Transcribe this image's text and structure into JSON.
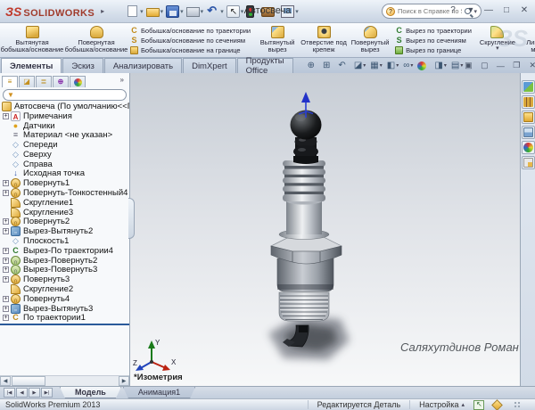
{
  "title_bar": {
    "logo_mark": "ЗS",
    "logo_text": "SOLIDWORKS",
    "document_title": "Автосвеча",
    "search_placeholder": "Поиск в Справке по SolidWorks",
    "menu_icons": [
      {
        "name": "new-document-icon",
        "icon": "new-document",
        "dd": true
      },
      {
        "name": "open-icon",
        "icon": "open",
        "dd": true
      },
      {
        "name": "save-icon",
        "icon": "save",
        "dd": true
      },
      {
        "name": "print-icon",
        "icon": "print",
        "dd": true
      },
      {
        "name": "undo-icon",
        "icon": "undo",
        "dd": true
      },
      {
        "name": "select-icon",
        "icon": "select",
        "dd": true
      },
      {
        "name": "rebuild-icon",
        "icon": "rebuild",
        "dd": false
      },
      {
        "name": "options-icon",
        "icon": "options",
        "dd": false
      },
      {
        "name": "view-settings-icon",
        "icon": "view-settings",
        "dd": true
      }
    ],
    "window_buttons": [
      {
        "name": "help-button",
        "glyph": "?"
      },
      {
        "name": "help-dropdown",
        "glyph": "▾"
      },
      {
        "name": "minimize-button",
        "glyph": "—"
      },
      {
        "name": "restore-button",
        "glyph": "□"
      },
      {
        "name": "close-button",
        "glyph": "✕"
      }
    ]
  },
  "ribbon": {
    "large_buttons_1": [
      {
        "name": "extruded-boss-button",
        "label": "Вытянутая бобышка/основание",
        "icon": "extruded-boss",
        "dd": false
      },
      {
        "name": "revolved-boss-button",
        "label": "Повернутая бобышка/основание",
        "icon": "revolved-boss",
        "dd": false
      }
    ],
    "stack_1": [
      {
        "name": "swept-boss-button",
        "label": "Бобышка/основание по траектории",
        "icon": "swept-boss"
      },
      {
        "name": "lofted-boss-button",
        "label": "Бобышка/основание по сечениям",
        "icon": "lofted-boss"
      },
      {
        "name": "boundary-boss-button",
        "label": "Бобышка/основание на границе",
        "icon": "boundary-boss"
      }
    ],
    "large_buttons_2": [
      {
        "name": "extruded-cut-button",
        "label": "Вытянутый вырез",
        "icon": "extruded-cut",
        "dd": false
      },
      {
        "name": "hole-wizard-button",
        "label": "Отверстие под крепеж",
        "icon": "hole-wizard",
        "dd": false
      },
      {
        "name": "revolved-cut-button",
        "label": "Повернутый вырез",
        "icon": "revolved-cut",
        "dd": false
      }
    ],
    "stack_2": [
      {
        "name": "swept-cut-button",
        "label": "Вырез по траектории",
        "icon": "swept-cut"
      },
      {
        "name": "lofted-cut-button",
        "label": "Вырез по сечениям",
        "icon": "lofted-cut"
      },
      {
        "name": "boundary-cut-button",
        "label": "Вырез по границе",
        "icon": "boundary-cut"
      }
    ],
    "large_buttons_3": [
      {
        "name": "fillet-button",
        "label": "Скругление",
        "icon": "fillet",
        "dd": true
      },
      {
        "name": "linear-pattern-button",
        "label": "Линейный массив",
        "icon": "linear-pattern",
        "dd": true
      }
    ],
    "overflow_glyph": "»",
    "tabs": [
      {
        "label": "Элементы",
        "active": true
      },
      {
        "label": "Эскиз"
      },
      {
        "label": "Анализировать"
      },
      {
        "label": "DimXpert"
      },
      {
        "label": "Продукты Office"
      }
    ]
  },
  "headsup_icons": [
    {
      "name": "zoom-fit-icon",
      "icon": "zoom-fit",
      "dd": false
    },
    {
      "name": "zoom-area-icon",
      "icon": "zoom-area",
      "dd": false
    },
    {
      "name": "previous-view-icon",
      "icon": "previous-view",
      "dd": false
    },
    {
      "name": "section-view-icon",
      "icon": "section-view",
      "dd": true
    },
    {
      "name": "view-orientation-icon",
      "icon": "view-orientation",
      "dd": true
    },
    {
      "name": "display-style-icon",
      "icon": "display-style",
      "dd": true
    },
    {
      "name": "hide-show-items-icon",
      "icon": "hide-show-items",
      "dd": true
    },
    {
      "name": "edit-appearance-icon",
      "icon": "edit-appearance",
      "dd": false
    },
    {
      "name": "apply-scene-icon",
      "icon": "apply-scene",
      "dd": true
    },
    {
      "name": "view-settings2-icon",
      "icon": "view-settings2",
      "dd": true
    }
  ],
  "document_window_buttons": [
    {
      "name": "previous-window-button",
      "glyph": "▣"
    },
    {
      "name": "next-window-button",
      "glyph": "▢"
    },
    {
      "name": "minimize-document-button",
      "glyph": "—"
    },
    {
      "name": "restore-document-button",
      "glyph": "❐"
    },
    {
      "name": "close-document-button",
      "glyph": "✕"
    }
  ],
  "panel": {
    "tabs": [
      {
        "name": "featuremanager-tab",
        "icon": "featuremanager",
        "active": true
      },
      {
        "name": "propertymanager-tab",
        "icon": "propertymanager",
        "active": false
      },
      {
        "name": "configurationmanager-tab",
        "icon": "configurationmanager",
        "active": false
      },
      {
        "name": "dimxpertmanager-tab",
        "icon": "dimxpertmanager",
        "active": false
      },
      {
        "name": "displaymanager-tab",
        "icon": "displaymanager",
        "active": false
      }
    ],
    "overflow_glyph": "»"
  },
  "feature_tree": {
    "items": [
      {
        "label": "Автосвеча (По умолчанию<<По",
        "icon": "part",
        "level": 0,
        "expandable": false
      },
      {
        "label": "Примечания",
        "icon": "annotations",
        "level": 1,
        "expandable": true
      },
      {
        "label": "Датчики",
        "icon": "sensors",
        "level": 1,
        "expandable": false
      },
      {
        "label": "Материал <не указан>",
        "icon": "material",
        "level": 1,
        "expandable": false
      },
      {
        "label": "Спереди",
        "icon": "plane",
        "level": 1,
        "expandable": false
      },
      {
        "label": "Сверху",
        "icon": "plane",
        "level": 1,
        "expandable": false
      },
      {
        "label": "Справа",
        "icon": "plane",
        "level": 1,
        "expandable": false
      },
      {
        "label": "Исходная точка",
        "icon": "origin",
        "level": 1,
        "expandable": false
      },
      {
        "label": "Повернуть1",
        "icon": "revolve",
        "level": 1,
        "expandable": true
      },
      {
        "label": "Повернуть-Тонкостенный4",
        "icon": "revolve",
        "level": 1,
        "expandable": true
      },
      {
        "label": "Скругление1",
        "icon": "fillet",
        "level": 1,
        "expandable": false
      },
      {
        "label": "Скругление3",
        "icon": "fillet",
        "level": 1,
        "expandable": false
      },
      {
        "label": "Повернуть2",
        "icon": "revolve",
        "level": 1,
        "expandable": true
      },
      {
        "label": "Вырез-Вытянуть2",
        "icon": "cut-extrude",
        "level": 1,
        "expandable": true
      },
      {
        "label": "Плоскость1",
        "icon": "plane",
        "level": 1,
        "expandable": false
      },
      {
        "label": "Вырез-По траектории4",
        "icon": "cut-sweep",
        "level": 1,
        "expandable": true
      },
      {
        "label": "Вырез-Повернуть2",
        "icon": "cut-revolve",
        "level": 1,
        "expandable": true
      },
      {
        "label": "Вырез-Повернуть3",
        "icon": "cut-revolve",
        "level": 1,
        "expandable": true
      },
      {
        "label": "Повернуть3",
        "icon": "revolve",
        "level": 1,
        "expandable": true
      },
      {
        "label": "Скругление2",
        "icon": "fillet",
        "level": 1,
        "expandable": false
      },
      {
        "label": "Повернуть4",
        "icon": "revolve",
        "level": 1,
        "expandable": true
      },
      {
        "label": "Вырез-Вытянуть3",
        "icon": "cut-extrude",
        "level": 1,
        "expandable": true
      },
      {
        "label": "По траектории1",
        "icon": "sweep",
        "level": 1,
        "expandable": true
      }
    ]
  },
  "viewport": {
    "view_label": "*Изометрия",
    "signature": "Саляхутдинов Роман",
    "triad_labels": {
      "x": "X",
      "y": "Y",
      "z": "Z"
    }
  },
  "task_pane_icons": [
    {
      "name": "solidworks-resources-icon",
      "icon": "resources"
    },
    {
      "name": "design-library-icon",
      "icon": "library"
    },
    {
      "name": "file-explorer-icon",
      "icon": "explorer"
    },
    {
      "name": "view-palette-icon",
      "icon": "palette"
    },
    {
      "name": "appearances-scenes-icon",
      "icon": "appearances"
    },
    {
      "name": "custom-properties-icon",
      "icon": "properties"
    }
  ],
  "bottom": {
    "nav_buttons": [
      {
        "name": "first-tab-button",
        "glyph": "|◀"
      },
      {
        "name": "previous-tab-button",
        "glyph": "◀"
      },
      {
        "name": "next-tab-button",
        "glyph": "▶"
      },
      {
        "name": "last-tab-button",
        "glyph": "▶|"
      }
    ],
    "tabs": [
      {
        "label": "Модель",
        "active": true
      },
      {
        "label": "Анимация1",
        "active": false
      }
    ]
  },
  "status_bar": {
    "product": "SolidWorks Premium 2013",
    "edit_state": "Редактируется Деталь",
    "config_label": "Настройка",
    "config_arrow": "▴"
  }
}
